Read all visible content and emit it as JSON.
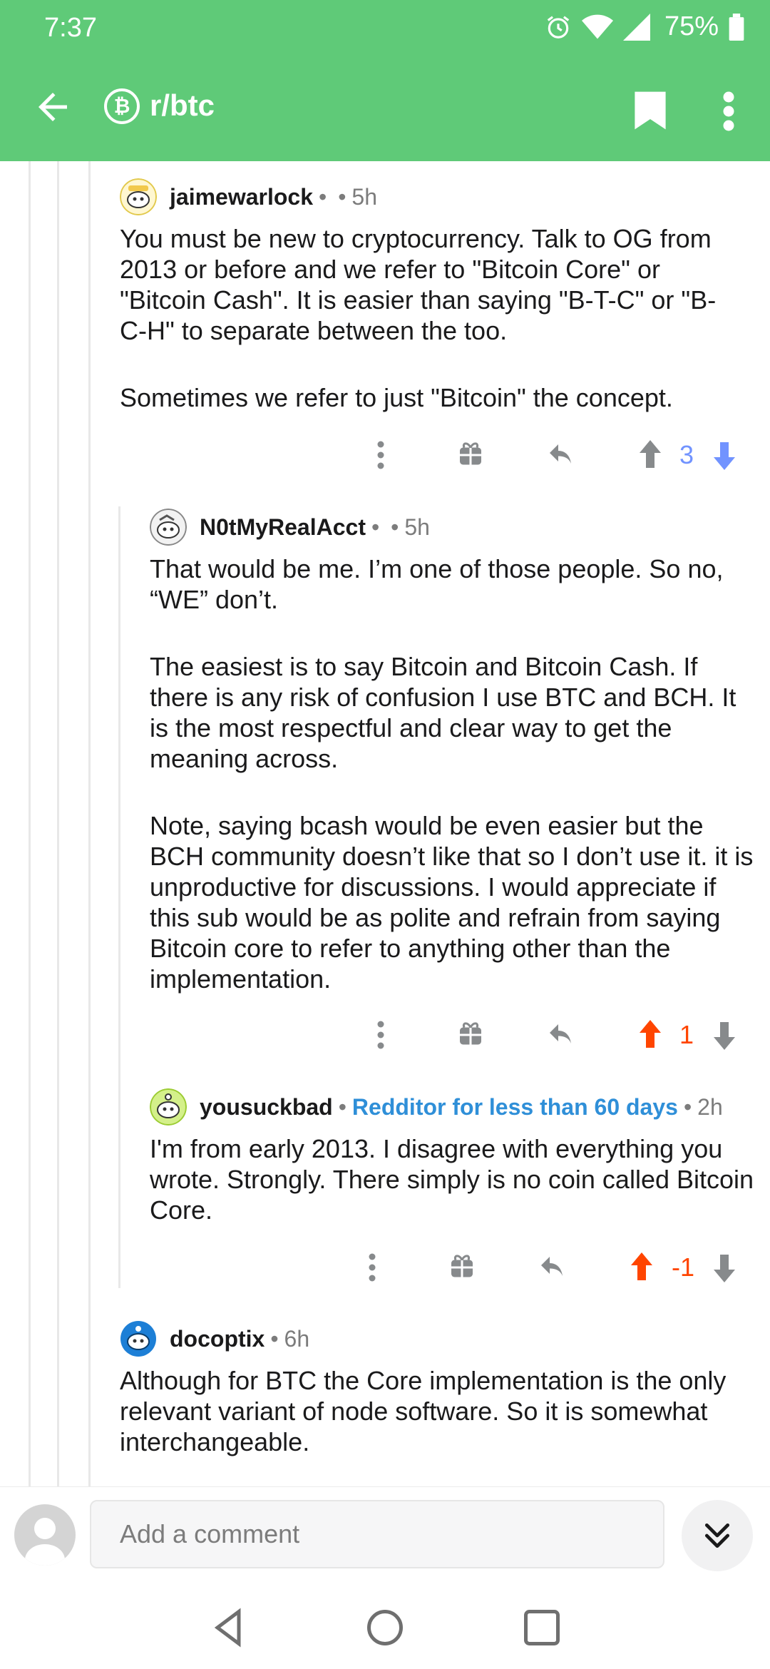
{
  "status_bar": {
    "time": "7:37",
    "battery": "75%"
  },
  "toolbar": {
    "subreddit": "r/btc",
    "subreddit_badge": "₿"
  },
  "colors": {
    "header": "#5fca78",
    "upvote_active": "#ff4500",
    "vote_blue": "#7193ff",
    "flair": "#2f8fd8"
  },
  "comments": [
    {
      "author": "jaimewarlock",
      "meta": "•",
      "time": "5h",
      "paragraphs": [
        "You must be new to cryptocurrency. Talk to OG from 2013 or before and we refer to \"Bitcoin Core\" or \"Bitcoin Cash\". It is easier than saying \"B-T-C\" or \"B-C-H\" to separate between the too.",
        "Sometimes we refer to just \"Bitcoin\" the concept."
      ],
      "score": "3"
    },
    {
      "author": "N0tMyRealAcct",
      "meta": "•",
      "time": "5h",
      "paragraphs": [
        "That would be me. I’m one of those people. So no, “WE” don’t.",
        "The easiest is to say Bitcoin and Bitcoin Cash. If there is any risk of confusion I use BTC and BCH. It is the most respectful and clear way to get the meaning across.",
        "Note, saying bcash would be even easier but the BCH community doesn’t like that so I don’t use it. it is unproductive for discussions. I would appreciate if this sub would be as polite and refrain from saying Bitcoin core to refer to anything other than the implementation."
      ],
      "score": "1"
    },
    {
      "author": "yousuckbad",
      "flair": "Redditor for less than 60 days",
      "time": "2h",
      "paragraphs": [
        "I'm from early 2013. I disagree with everything you wrote. Strongly. There simply is no coin called Bitcoin Core."
      ],
      "score": "-1"
    },
    {
      "author": "docoptix",
      "time": "6h",
      "paragraphs": [
        "Although for BTC the Core implementation is the only relevant variant of node software. So it is somewhat interchangeable."
      ]
    }
  ],
  "comment_box": {
    "placeholder": "Add a comment"
  },
  "icons": [
    "back-arrow-icon",
    "bitcoin-icon",
    "bookmark-icon",
    "more-vert-icon",
    "gift-icon",
    "reply-icon",
    "upvote-icon",
    "downvote-icon",
    "collapse-down-icon",
    "nav-back-icon",
    "nav-home-icon",
    "nav-recents-icon",
    "alarm-icon",
    "wifi-icon",
    "signal-icon",
    "battery-icon"
  ]
}
